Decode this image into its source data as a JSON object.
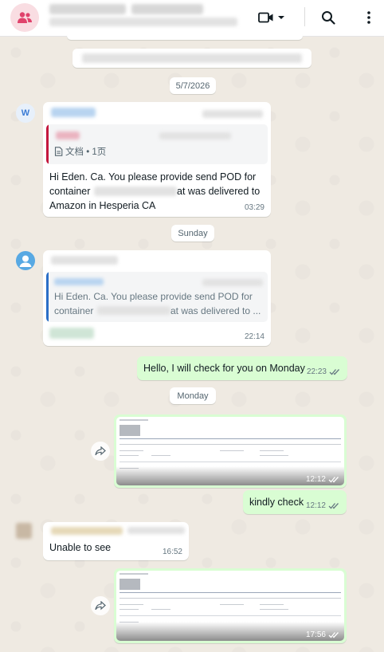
{
  "header": {
    "video_icon": "video-camera-icon",
    "dropdown_icon": "chevron-down-icon",
    "search_icon": "search-icon",
    "menu_icon": "more-vertical-icon"
  },
  "chat": {
    "date_chip_1": "5/7/2026",
    "date_chip_2": "Sunday",
    "date_chip_3": "Monday",
    "msg1": {
      "avatar_letter": "W",
      "doc_meta": "文档 • 1页",
      "text_a": "Hi Eden. Ca. You please provide send POD for",
      "text_b_pre": "container",
      "text_b_post": "at was delivered to",
      "text_c": "Amazon in Hesperia CA",
      "time": "03:29"
    },
    "msg2": {
      "quote_line1": "Hi Eden. Ca. You please provide send POD for",
      "quote_line2_pre": "container",
      "quote_line2_post": "at was delivered to ...",
      "time": "22:14"
    },
    "msg3": {
      "text": "Hello, I will check for you on Monday",
      "time": "22:23"
    },
    "msg4": {
      "time": "12:12"
    },
    "msg5": {
      "text": "kindly check",
      "time": "12:12"
    },
    "msg6": {
      "text": "Unable to see",
      "time": "16:52"
    },
    "msg7": {
      "time": "17:56"
    }
  },
  "colors": {
    "chat_bg": "#efeae2",
    "outgoing_bubble": "#d9fdd3",
    "incoming_bubble": "#ffffff",
    "quote_bar_red": "#c4173d",
    "quote_bar_blue": "#2b6fc7"
  }
}
